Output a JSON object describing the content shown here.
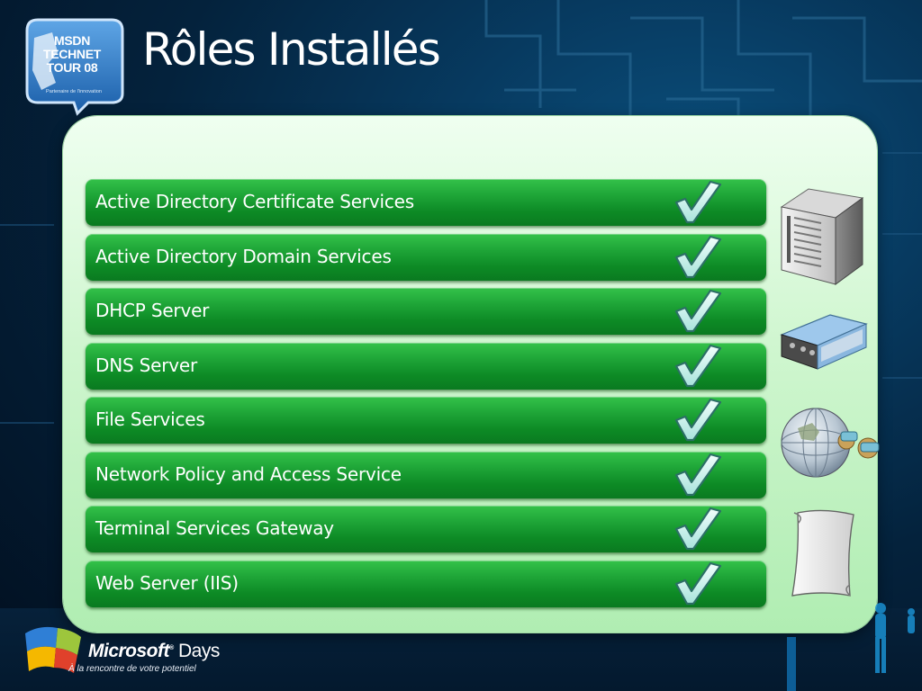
{
  "slide": {
    "title": "Rôles Installés"
  },
  "badge": {
    "lines": [
      "MSDN",
      "TECHNET",
      "TOUR 08"
    ],
    "subtitle": "Partenaire de l'innovation"
  },
  "roles": [
    {
      "label": "Active Directory Certificate Services",
      "installed": true
    },
    {
      "label": "Active Directory Domain Services",
      "installed": true
    },
    {
      "label": "DHCP Server",
      "installed": true
    },
    {
      "label": "DNS Server",
      "installed": true
    },
    {
      "label": "File Services",
      "installed": true
    },
    {
      "label": "Network Policy and Access Service",
      "installed": true
    },
    {
      "label": "Terminal Services Gateway",
      "installed": true
    },
    {
      "label": "Web Server (IIS)",
      "installed": true
    }
  ],
  "side_icons": [
    "server-tower-icon",
    "binder-icon",
    "globe-network-icon",
    "scroll-certificate-icon"
  ],
  "footer": {
    "brand": "Microsoft",
    "brand_suffix": "Days",
    "tagline": "À la rencontre de votre potentiel"
  },
  "colors": {
    "panel": "#c8f3c9",
    "row_green": "#1ea537",
    "check": "#c8f0ea",
    "background": "#04223c"
  }
}
